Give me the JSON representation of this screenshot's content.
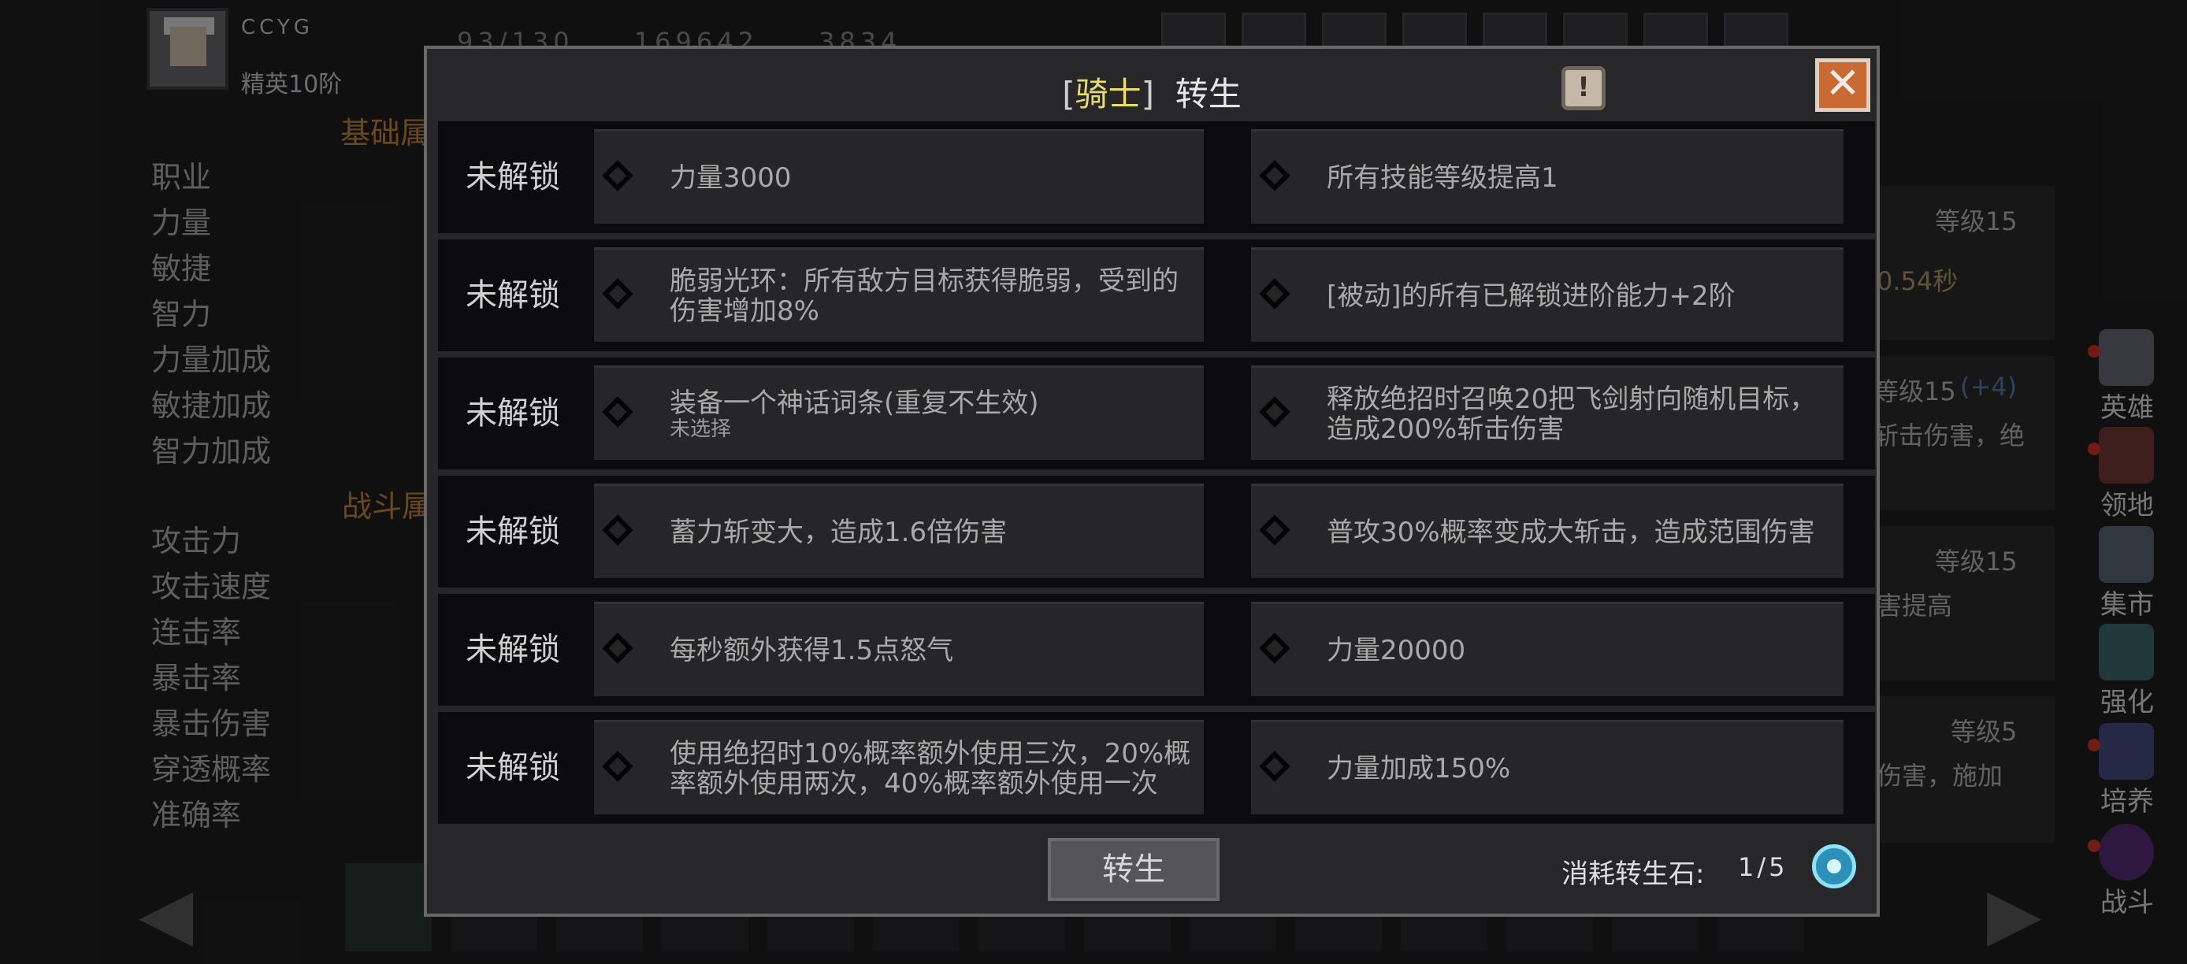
{
  "background": {
    "player": {
      "name": "CCYG",
      "rank": "精英10阶"
    },
    "stat_strip": [
      "93/130",
      "169642",
      "3834"
    ],
    "sections": {
      "base": "基础属",
      "combat": "战斗属"
    },
    "base_stats": [
      "职业",
      "力量",
      "敏捷",
      "智力",
      "力量加成",
      "敏捷加成",
      "智力加成"
    ],
    "combat_stats": [
      "攻击力",
      "攻击速度",
      "连击率",
      "暴击率",
      "暴击伤害",
      "穿透概率",
      "准确率"
    ],
    "right_panels": [
      {
        "level": "等级15",
        "text": "0.54秒"
      },
      {
        "level": "等级15",
        "bonus": "(+4)",
        "text": "斩击伤害，绝"
      },
      {
        "level": "等级15",
        "text": "害提高"
      },
      {
        "level": "等级5",
        "text": "伤害，施加"
      }
    ],
    "sidebar": [
      "英雄",
      "领地",
      "集市",
      "强化",
      "培养",
      "战斗"
    ]
  },
  "dialog": {
    "title_class": "骑士",
    "title_text": "转生",
    "info_icon": "exclamation-icon",
    "close_icon": "close-icon",
    "tiers": [
      {
        "status": "未解锁",
        "left": {
          "text": "力量3000",
          "sub": ""
        },
        "right": {
          "text": "所有技能等级提高1"
        }
      },
      {
        "status": "未解锁",
        "left": {
          "text": "脆弱光环：所有敌方目标获得脆弱，受到的伤害增加8%",
          "sub": ""
        },
        "right": {
          "text": "[被动]的所有已解锁进阶能力+2阶"
        }
      },
      {
        "status": "未解锁",
        "left": {
          "text": "装备一个神话词条(重复不生效)",
          "sub": "未选择"
        },
        "right": {
          "text": "释放绝招时召唤20把飞剑射向随机目标，造成200%斩击伤害"
        }
      },
      {
        "status": "未解锁",
        "left": {
          "text": "蓄力斩变大，造成1.6倍伤害",
          "sub": ""
        },
        "right": {
          "text": "普攻30%概率变成大斩击，造成范围伤害"
        }
      },
      {
        "status": "未解锁",
        "left": {
          "text": "每秒额外获得1.5点怒气",
          "sub": ""
        },
        "right": {
          "text": "力量20000"
        }
      },
      {
        "status": "未解锁",
        "left": {
          "text": "使用绝招时10%概率额外使用三次，20%概率额外使用两次，40%概率额外使用一次",
          "sub": ""
        },
        "right": {
          "text": "力量加成150%"
        }
      }
    ],
    "rebirth_button": "转生",
    "cost_label": "消耗转生石:",
    "cost_value": "1/5",
    "cost_icon": "rebirth-stone-icon"
  }
}
